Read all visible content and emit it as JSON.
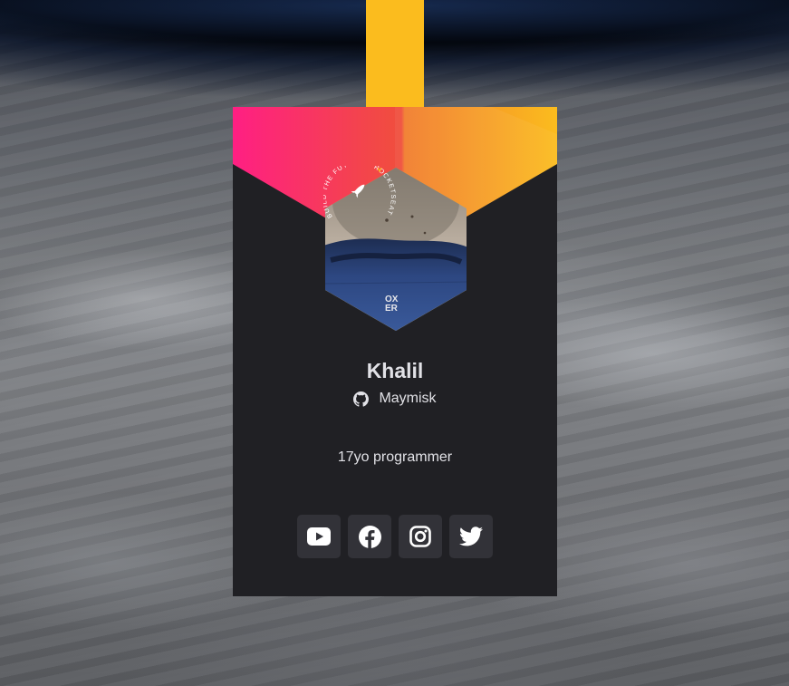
{
  "profile": {
    "name": "Khalil",
    "github_username": "Maymisk",
    "bio": "17yo programmer"
  },
  "seal": {
    "text": "BUILD THE FUTURE · ROCKETSEAT ·"
  },
  "avatar": {
    "shirt_logo_line1": "OX",
    "shirt_logo_line2": "ER"
  },
  "socials": [
    {
      "name": "YouTube",
      "icon": "youtube-icon"
    },
    {
      "name": "Facebook",
      "icon": "facebook-icon"
    },
    {
      "name": "Instagram",
      "icon": "instagram-icon"
    },
    {
      "name": "Twitter",
      "icon": "twitter-icon"
    }
  ],
  "colors": {
    "card_background": "#202024",
    "strap": "#fbbc1e",
    "gradient_start": "#ff1f83",
    "gradient_end": "#fbbc1e",
    "button_background": "#323238",
    "text": "#e1e1e6"
  }
}
